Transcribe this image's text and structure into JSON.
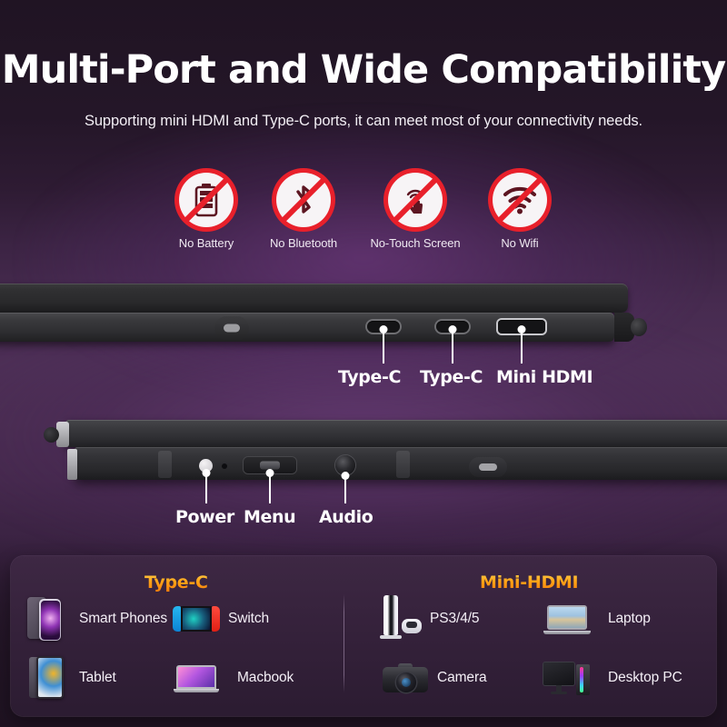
{
  "header": {
    "title": "Multi-Port and Wide Compatibility",
    "subtitle": "Supporting mini HDMI and Type-C ports, it can meet most of your connectivity needs."
  },
  "badges": [
    {
      "label": "No Battery",
      "icon": "no-battery-icon"
    },
    {
      "label": "No Bluetooth",
      "icon": "no-bluetooth-icon"
    },
    {
      "label": "No-Touch Screen",
      "icon": "no-touch-screen-icon"
    },
    {
      "label": "No Wifi",
      "icon": "no-wifi-icon"
    }
  ],
  "port_callouts": [
    {
      "label": "Type-C"
    },
    {
      "label": "Type-C"
    },
    {
      "label": "Mini HDMI"
    }
  ],
  "control_callouts": [
    {
      "label": "Power"
    },
    {
      "label": "Menu"
    },
    {
      "label": "Audio"
    }
  ],
  "compatibility": {
    "typec": {
      "heading": "Type-C",
      "items": [
        {
          "label": "Smart Phones",
          "thumb": "smartphone-thumb"
        },
        {
          "label": "Switch",
          "thumb": "switch-thumb"
        },
        {
          "label": "Tablet",
          "thumb": "tablet-thumb"
        },
        {
          "label": "Macbook",
          "thumb": "macbook-thumb"
        }
      ]
    },
    "hdmi": {
      "heading": "Mini-HDMI",
      "items": [
        {
          "label": "PS3/4/5",
          "thumb": "ps5-thumb"
        },
        {
          "label": "Laptop",
          "thumb": "laptop-thumb"
        },
        {
          "label": "Camera",
          "thumb": "camera-thumb"
        },
        {
          "label": "Desktop PC",
          "thumb": "desktop-pc-thumb"
        }
      ]
    }
  },
  "colors": {
    "background_dark": "#201423",
    "background_purple": "#4a2d52",
    "prohibition_red": "#e8202b",
    "heading_orange": "#ffa317",
    "text_white": "#ffffff"
  }
}
